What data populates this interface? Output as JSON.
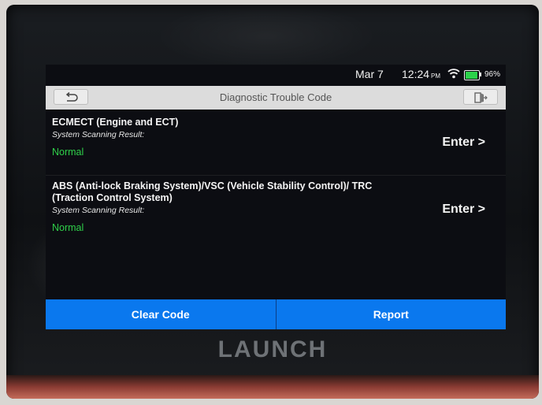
{
  "status_bar": {
    "date": "Mar 7",
    "time": "12:24",
    "ampm": "PM",
    "battery": "96%",
    "battery_level": 0.96,
    "wifi_icon": "wifi-icon",
    "battery_color": "#2bd14a"
  },
  "header": {
    "title": "Diagnostic Trouble Code",
    "back_icon": "back-arrow-icon",
    "exit_icon": "exit-icon"
  },
  "systems": [
    {
      "name": "ECMECT (Engine and ECT)",
      "result_label": "System Scanning Result:",
      "result": "Normal",
      "action": "Enter >"
    },
    {
      "name": "ABS (Anti-lock Braking System)/VSC (Vehicle Stability Control)/ TRC (Traction Control System)",
      "result_label": "System Scanning Result:",
      "result": "Normal",
      "action": "Enter >"
    }
  ],
  "footer": {
    "clear_code": "Clear Code",
    "report": "Report"
  },
  "device": {
    "brand": "LAUNCH"
  },
  "colors": {
    "accent_blue": "#0a78ee",
    "normal_green": "#2fd04a"
  }
}
